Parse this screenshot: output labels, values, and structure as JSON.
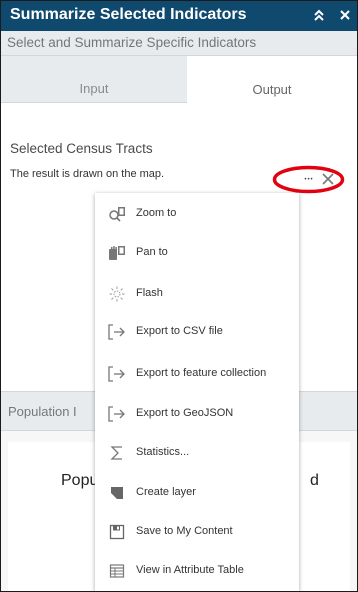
{
  "header": {
    "title": "Summarize Selected Indicators",
    "subtitle": "Select and Summarize Specific Indicators"
  },
  "tabs": [
    {
      "label": "Input",
      "active": false
    },
    {
      "label": "Output",
      "active": true
    }
  ],
  "result": {
    "title": "Selected Census Tracts",
    "description": "The result is drawn on the map.",
    "more_label": "•••",
    "close_label": "×"
  },
  "background_section": {
    "header": "Population I",
    "card_left": "Popu",
    "card_right": "d"
  },
  "menu": {
    "items": [
      {
        "label": "Zoom to",
        "icon": "zoom-to-icon"
      },
      {
        "label": "Pan to",
        "icon": "pan-to-icon"
      },
      {
        "label": "Flash",
        "icon": "flash-icon"
      },
      {
        "label": "Export to CSV file",
        "icon": "export-icon"
      },
      {
        "label": "Export to feature collection",
        "icon": "export-icon"
      },
      {
        "label": "Export to GeoJSON",
        "icon": "export-icon"
      },
      {
        "label": "Statistics...",
        "icon": "sigma-icon"
      },
      {
        "label": "Create layer",
        "icon": "create-layer-icon"
      },
      {
        "label": "Save to My Content",
        "icon": "save-icon"
      },
      {
        "label": "View in Attribute Table",
        "icon": "table-icon"
      }
    ]
  },
  "colors": {
    "header_bg": "#10496e",
    "highlight_ring": "#e3000f",
    "icon_gray": "#777777"
  }
}
